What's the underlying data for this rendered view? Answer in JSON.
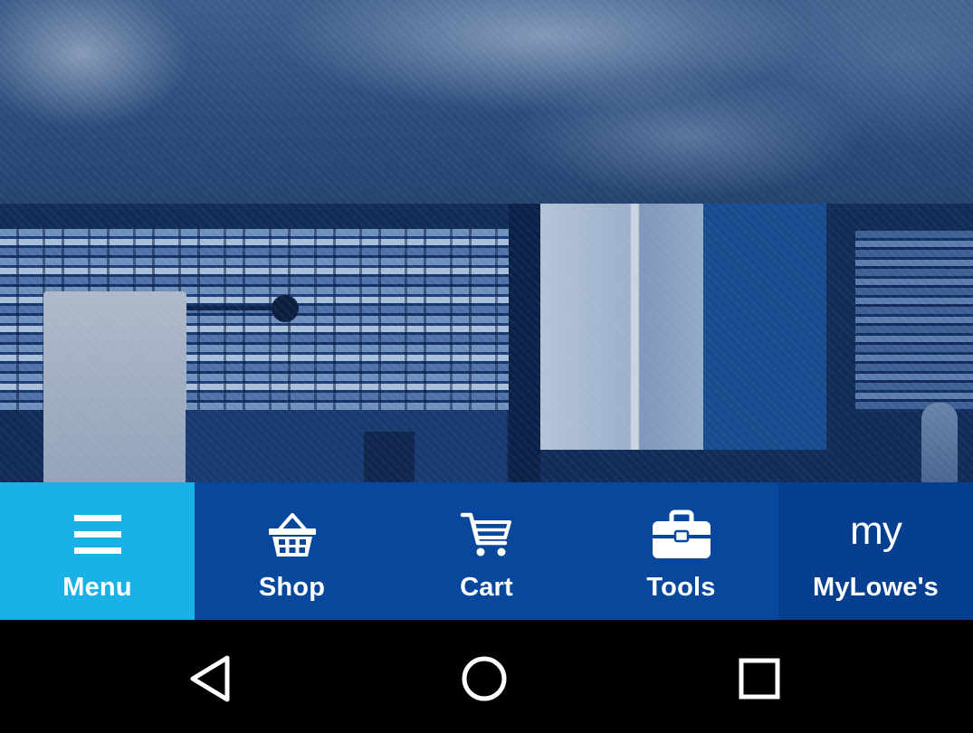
{
  "colors": {
    "tab_active": "#1ab1e6",
    "tab_bar": "#07489c",
    "tab_mylowes": "#063f8f",
    "nav_bar": "#000000",
    "icon": "#ffffff"
  },
  "tabs": [
    {
      "label": "Menu",
      "icon": "hamburger-icon",
      "active": true
    },
    {
      "label": "Shop",
      "icon": "basket-icon",
      "active": false
    },
    {
      "label": "Cart",
      "icon": "cart-icon",
      "active": false
    },
    {
      "label": "Tools",
      "icon": "toolbox-icon",
      "active": false
    },
    {
      "label": "MyLowe's",
      "icon": "my-logo-icon",
      "icon_text": "my",
      "active": false
    }
  ],
  "system_nav": [
    {
      "icon": "back-triangle-icon"
    },
    {
      "icon": "home-circle-icon"
    },
    {
      "icon": "recents-square-icon"
    }
  ]
}
